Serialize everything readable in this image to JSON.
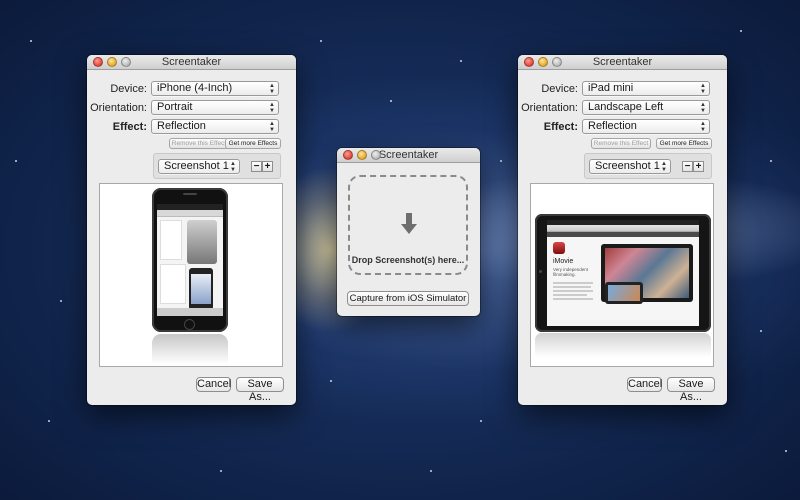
{
  "window_left": {
    "title": "Screentaker",
    "device_label": "Device:",
    "device_value": "iPhone (4-Inch)",
    "orientation_label": "Orientation:",
    "orientation_value": "Portrait",
    "effect_label": "Effect:",
    "effect_value": "Reflection",
    "remove_effect_label": "Remove this Effect",
    "get_effects_label": "Get more Effects",
    "screenshot_value": "Screenshot 1",
    "minus_label": "−",
    "plus_label": "+",
    "cancel_label": "Cancel",
    "save_label": "Save As..."
  },
  "window_center": {
    "title": "Screentaker",
    "drop_text": "Drop Screenshot(s) here...",
    "capture_label": "Capture from iOS Simulator"
  },
  "window_right": {
    "title": "Screentaker",
    "device_label": "Device:",
    "device_value": "iPad mini",
    "orientation_label": "Orientation:",
    "orientation_value": "Landscape Left",
    "effect_label": "Effect:",
    "effect_value": "Reflection",
    "remove_effect_label": "Remove this Effect",
    "get_effects_label": "Get more Effects",
    "screenshot_value": "Screenshot 1",
    "minus_label": "−",
    "plus_label": "+",
    "cancel_label": "Cancel",
    "save_label": "Save As...",
    "ipad_app_title": "iMovie",
    "ipad_app_tagline": "Very independent filmmaking."
  },
  "icons": {
    "popup_arrows": "▲▼",
    "drop_arrow": "download-arrow-icon"
  },
  "colors": {
    "window_bg": "#ececec",
    "close_red": "#e0443a",
    "minimize_yellow": "#e5a82a"
  }
}
